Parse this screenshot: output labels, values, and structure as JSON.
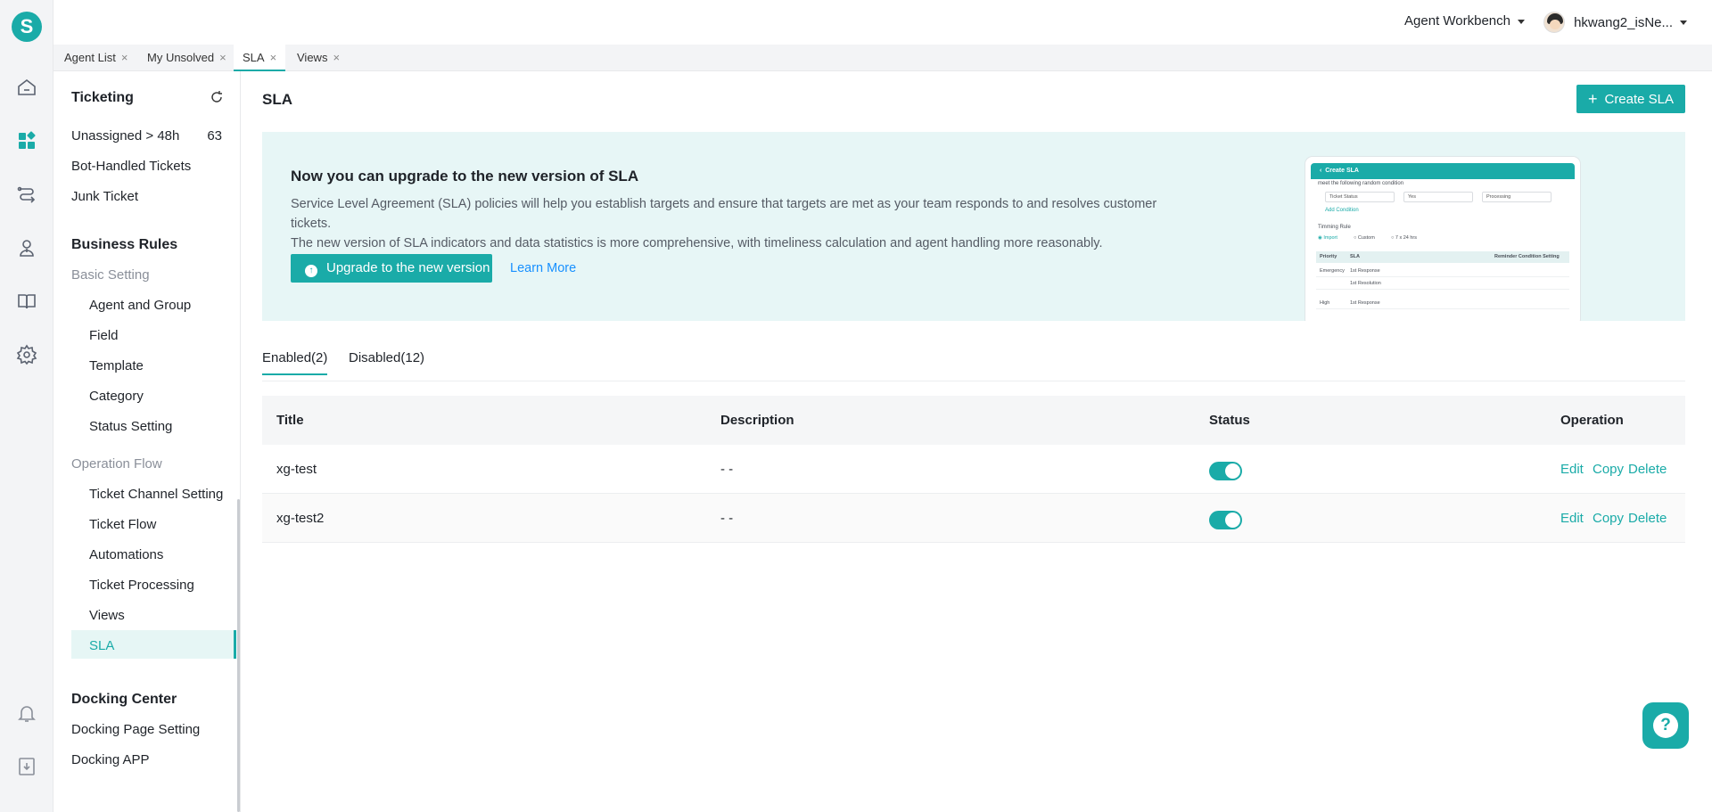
{
  "brand": {
    "logo_letter": "S",
    "accent": "#1aaba8"
  },
  "rail": {
    "top_icons": [
      "home-icon",
      "dashboard-icon",
      "routing-icon",
      "agent-icon",
      "knowledge-book-icon",
      "settings-icon"
    ],
    "bottom_icons": [
      "bell-icon",
      "download-icon"
    ]
  },
  "topbar": {
    "workbench_label": "Agent Workbench",
    "user_name": "hkwang2_isNe..."
  },
  "page_tabs": [
    {
      "label": "Agent List",
      "close": "×"
    },
    {
      "label": "My Unsolved",
      "close": "×"
    },
    {
      "label": "SLA",
      "close": "×"
    },
    {
      "label": "Views",
      "close": "×"
    }
  ],
  "sidebar": {
    "ticketing": {
      "title": "Ticketing",
      "unassigned": {
        "label": "Unassigned  >  48h",
        "count": "63"
      },
      "items": [
        "Bot-Handled Tickets",
        "Junk Ticket"
      ]
    },
    "business_rules": {
      "title": "Business Rules",
      "basic_setting": {
        "label": "Basic Setting",
        "items": [
          "Agent and Group",
          "Field",
          "Template",
          "Category",
          "Status Setting"
        ]
      },
      "operation_flow": {
        "label": "Operation Flow",
        "items": [
          "Ticket Channel Setting",
          "Ticket Flow",
          "Automations",
          "Ticket Processing",
          "Views",
          "SLA"
        ]
      }
    },
    "docking_center": {
      "title": "Docking Center",
      "items": [
        "Docking Page Setting",
        "Docking APP"
      ]
    }
  },
  "main": {
    "title": "SLA",
    "create_button": "Create SLA",
    "create_plus": "+",
    "banner": {
      "title": "Now you can upgrade to the new version of SLA",
      "desc_line1": "Service Level Agreement (SLA) policies will help you establish targets and ensure that targets are met as your team responds to and resolves customer tickets.",
      "desc_line2": "The new version of SLA indicators and data statistics is more comprehensive, with timeliness calculation and agent handling more reasonably.",
      "upgrade_button": "Upgrade to the new version",
      "learn_more": "Learn More",
      "preview": {
        "header": "Create SLA",
        "condition_text": "meet the following random condition",
        "select1": "Ticket Status",
        "select2": "Yes",
        "select3": "Processing",
        "add_condition": "Add Condition",
        "timing_rule": "Timming Rule",
        "radio1": "Import",
        "radio2": "Custom",
        "radio3": "7 x 24 hrs",
        "col_priority": "Priority",
        "col_sla": "SLA",
        "col_reminder": "Reminder Condition Setting",
        "row1_priority": "Emergency",
        "row1_metric": "1st Response",
        "row2_metric": "1st Resolution",
        "row3_priority": "High",
        "row3_metric": "1st Response"
      }
    },
    "list_tabs": [
      {
        "label": "Enabled(2)"
      },
      {
        "label": "Disabled(12)"
      }
    ],
    "table": {
      "headers": {
        "title": "Title",
        "description": "Description",
        "status": "Status",
        "operation": "Operation"
      },
      "rows": [
        {
          "title": "xg-test",
          "description": "- -",
          "enabled": true
        },
        {
          "title": "xg-test2",
          "description": "- -",
          "enabled": true
        }
      ],
      "ops": {
        "edit": "Edit",
        "copy": "Copy",
        "delete": "Delete"
      }
    }
  },
  "help": {
    "glyph": "?"
  }
}
